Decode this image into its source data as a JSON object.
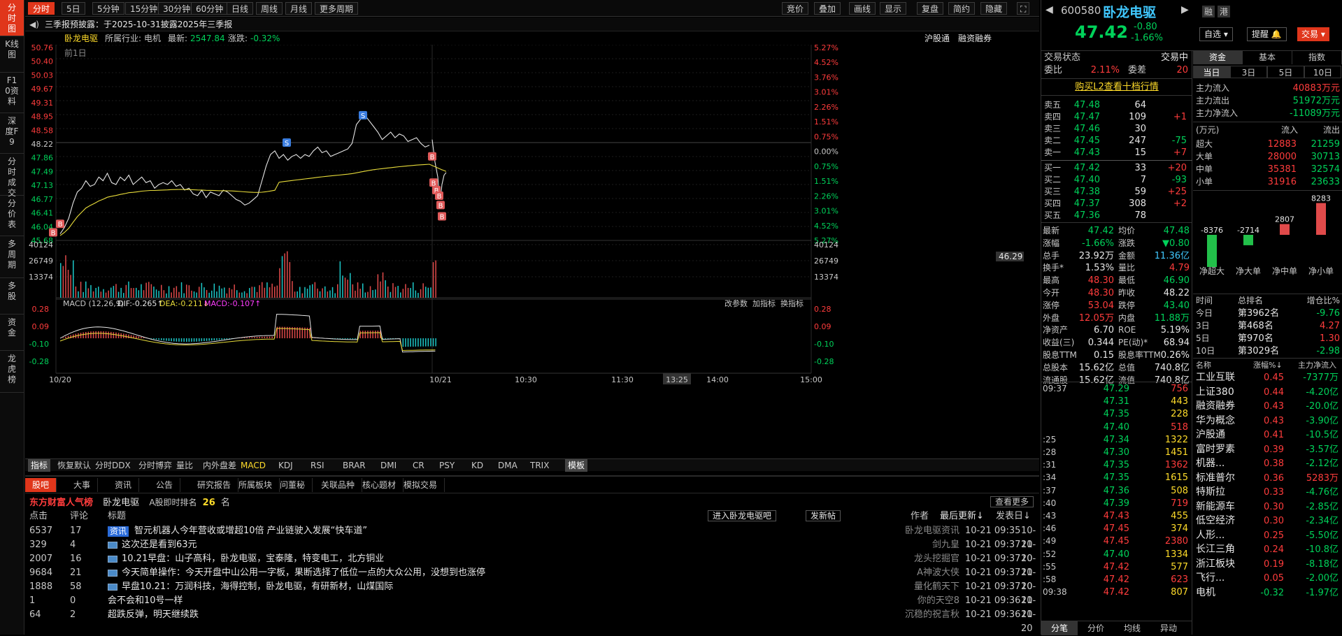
{
  "left_tabs": [
    "分时图",
    "K线图",
    "F10资料",
    "深度F9",
    "分时成交",
    "分价表",
    "多周期",
    "多股",
    "资金",
    "龙虎榜"
  ],
  "period_tabs": [
    "分时",
    "5日",
    "5分钟",
    "15分钟",
    "30分钟",
    "60分钟",
    "日线",
    "周线",
    "月线",
    "更多周期"
  ],
  "tool_buttons": [
    "竞价",
    "叠加",
    "画线",
    "显示",
    "复盘",
    "简约",
    "隐藏"
  ],
  "announcement": "三季报预披露：于2025-10-31披露2025年三季报",
  "info_line": {
    "name": "卧龙电驱",
    "industry_label": "所属行业:",
    "industry": "电机",
    "latest_label": "最新:",
    "latest": "2547.84",
    "change_label": "涨跌:",
    "change": "-0.32%",
    "hk_connect": "沪股通",
    "margin": "融资融券"
  },
  "price_axis_left": [
    "50.76",
    "50.40",
    "50.03",
    "49.67",
    "49.31",
    "48.95",
    "48.58",
    "48.22",
    "47.86",
    "47.49",
    "47.13",
    "46.77",
    "46.41",
    "46.04",
    "45.68"
  ],
  "price_axis_right": [
    "5.27%",
    "4.52%",
    "3.76%",
    "3.01%",
    "2.26%",
    "1.51%",
    "0.75%",
    "0.00%",
    "0.75%",
    "1.51%",
    "2.26%",
    "3.01%",
    "4.52%",
    "5.27%"
  ],
  "prev_day_label": "前1日",
  "current_price_tag": "46.29",
  "volume_axis": [
    "40124",
    "26749",
    "13374"
  ],
  "macd": {
    "title": "MACD (12,26,9)",
    "dif": "DIF:-0.265↑",
    "dea": "DEA:-0.211↓",
    "macd": "MACD:-0.107↑",
    "axis": [
      "0.28",
      "0.09",
      "-0.10",
      "-0.28"
    ],
    "buttons": [
      "改参数",
      "加指标",
      "换指标"
    ]
  },
  "time_axis": [
    "10/20",
    "10/21",
    "10:30",
    "11:30",
    "13:25",
    "14:00",
    "15:00"
  ],
  "indicator_tabs": [
    "指标",
    "恢复默认",
    "分时DDX",
    "分时博弈",
    "量比",
    "内外盘差",
    "MACD",
    "KDJ",
    "RSI",
    "BRAR",
    "DMI",
    "CR",
    "PSY",
    "KD",
    "DMA",
    "TRIX",
    "模板"
  ],
  "forum": {
    "tabs": [
      "股吧",
      "大事",
      "资讯",
      "公告",
      "研究报告",
      "所属板块",
      "问董秘",
      "关联品种",
      "核心题材",
      "模拟交易"
    ],
    "popularity_title": "东方财富人气榜",
    "stock": "卧龙电驱",
    "rank_label": "A股即时排名",
    "rank": "26",
    "rank_unit": "名",
    "more": "查看更多",
    "col_clicks": "点击",
    "col_comments": "评论",
    "col_title": "标题",
    "enter_btn": "进入卧龙电驱吧",
    "post_btn": "发新帖",
    "col_author": "作者",
    "col_updated": "最后更新↓",
    "col_posted": "发表日↓",
    "rows": [
      {
        "clicks": "6537",
        "comments": "17",
        "tag": "资讯",
        "title": "智元机器人今年营收或增超10倍 产业链驶入发展“快车道”",
        "author": "卧龙电驱资讯",
        "updated": "10-21 09:35",
        "posted": "10-21"
      },
      {
        "clicks": "329",
        "comments": "4",
        "tag": "",
        "title": "这次还是看到63元",
        "author": "剑九皇",
        "updated": "10-21 09:37",
        "posted": "10-20"
      },
      {
        "clicks": "2007",
        "comments": "16",
        "tag": "",
        "title": "10.21早盘：山子高科，卧龙电驱，宝泰隆，特变电工，北方铜业",
        "author": "龙头挖掘官",
        "updated": "10-21 09:37",
        "posted": "10-21"
      },
      {
        "clicks": "9684",
        "comments": "21",
        "tag": "",
        "title": "今天简单操作：今天开盘中山公用一字板，果断选择了低位一点的大众公用，没想到也涨停",
        "author": "A神波大侠",
        "updated": "10-21 09:37",
        "posted": "10-20"
      },
      {
        "clicks": "1888",
        "comments": "58",
        "tag": "",
        "title": "早盘10.21：万润科技，海得控制，卧龙电驱，有研新材，山煤国际",
        "author": "量化鹤天下",
        "updated": "10-21 09:37",
        "posted": "10-21"
      },
      {
        "clicks": "1",
        "comments": "0",
        "tag": "",
        "title": "会不会和10号一样",
        "author": "你的天空8",
        "updated": "10-21 09:36",
        "posted": "10-21"
      },
      {
        "clicks": "64",
        "comments": "2",
        "tag": "",
        "title": "超跌反弹，明天继续跌",
        "author": "沉稳的祝言秋",
        "updated": "10-21 09:36",
        "posted": "10-20"
      }
    ]
  },
  "quote": {
    "code": "600580",
    "name": "卧龙电驱",
    "btn_rong": "融",
    "btn_gang": "港",
    "price": "47.42",
    "change": "-0.80",
    "pct": "-1.66%",
    "watch": "自选",
    "alert": "提醒",
    "trade": "交易",
    "status_label": "交易状态",
    "status": "交易中",
    "ratio_label": "委比",
    "ratio": "2.11%",
    "diff_label": "委差",
    "diff": "20",
    "l2_link": "购买L2查看十档行情",
    "asks": [
      {
        "label": "卖五",
        "price": "47.48",
        "vol": "64",
        "chg": ""
      },
      {
        "label": "卖四",
        "price": "47.47",
        "vol": "109",
        "chg": "+1"
      },
      {
        "label": "卖三",
        "price": "47.46",
        "vol": "30",
        "chg": ""
      },
      {
        "label": "卖二",
        "price": "47.45",
        "vol": "247",
        "chg": "-75"
      },
      {
        "label": "卖一",
        "price": "47.43",
        "vol": "15",
        "chg": "+7"
      }
    ],
    "bids": [
      {
        "label": "买一",
        "price": "47.42",
        "vol": "33",
        "chg": "+20"
      },
      {
        "label": "买二",
        "price": "47.40",
        "vol": "7",
        "chg": "-93"
      },
      {
        "label": "买三",
        "price": "47.38",
        "vol": "59",
        "chg": "+25"
      },
      {
        "label": "买四",
        "price": "47.37",
        "vol": "308",
        "chg": "+2"
      },
      {
        "label": "买五",
        "price": "47.36",
        "vol": "78",
        "chg": ""
      }
    ],
    "stats": [
      [
        "最新",
        "47.42",
        "均价",
        "47.48"
      ],
      [
        "涨幅",
        "-1.66%",
        "涨跌",
        "▼0.80"
      ],
      [
        "总手",
        "23.92万",
        "金额",
        "11.36亿"
      ],
      [
        "换手*",
        "1.53%",
        "量比",
        "4.79"
      ],
      [
        "最高",
        "48.30",
        "最低",
        "46.90"
      ],
      [
        "今开",
        "48.30",
        "昨收",
        "48.22"
      ],
      [
        "涨停",
        "53.04",
        "跌停",
        "43.40"
      ],
      [
        "外盘",
        "12.05万",
        "内盘",
        "11.88万"
      ],
      [
        "净资产",
        "6.70",
        "ROE",
        "5.19%"
      ],
      [
        "收益(三)",
        "0.344",
        "PE(动)*",
        "68.94"
      ],
      [
        "股息TTM",
        "0.15",
        "股息率TTM",
        "0.26%"
      ],
      [
        "总股本",
        "15.62亿",
        "总值",
        "740.8亿"
      ],
      [
        "流通股",
        "15.62亿",
        "流值",
        "740.8亿"
      ]
    ],
    "ticks": [
      {
        "t": "09:37",
        "p": "47.29",
        "v": "756"
      },
      {
        "t": "",
        "p": "47.31",
        "v": "443"
      },
      {
        "t": "",
        "p": "47.35",
        "v": "228"
      },
      {
        "t": "",
        "p": "47.40",
        "v": "518"
      },
      {
        "t": ":25",
        "p": "47.34",
        "v": "1322"
      },
      {
        "t": ":28",
        "p": "47.30",
        "v": "1451"
      },
      {
        "t": ":31",
        "p": "47.35",
        "v": "1362"
      },
      {
        "t": ":34",
        "p": "47.35",
        "v": "1615"
      },
      {
        "t": ":37",
        "p": "47.36",
        "v": "508"
      },
      {
        "t": ":40",
        "p": "47.39",
        "v": "719"
      },
      {
        "t": ":43",
        "p": "47.43",
        "v": "455"
      },
      {
        "t": ":46",
        "p": "47.45",
        "v": "374"
      },
      {
        "t": ":49",
        "p": "47.45",
        "v": "2380"
      },
      {
        "t": ":52",
        "p": "47.40",
        "v": "1334"
      },
      {
        "t": ":55",
        "p": "47.42",
        "v": "577"
      },
      {
        "t": ":58",
        "p": "47.42",
        "v": "623"
      },
      {
        "t": "09:38",
        "p": "47.42",
        "v": "807"
      }
    ],
    "bottom_tabs": [
      "分笔",
      "分价",
      "均线",
      "异动"
    ]
  },
  "fund": {
    "tabs": [
      "资金",
      "基本",
      "指数"
    ],
    "period_tabs": [
      "当日",
      "3日",
      "5日",
      "10日"
    ],
    "inflow_label": "主力流入",
    "inflow": "40883万元",
    "outflow_label": "主力流出",
    "outflow": "51972万元",
    "net_label": "主力净流入",
    "net": "-11089万元",
    "unit": "(万元)",
    "in_label": "流入",
    "out_label": "流出",
    "sizes": [
      [
        "超大",
        "12883",
        "21259"
      ],
      [
        "大单",
        "28000",
        "30713"
      ],
      [
        "中单",
        "35381",
        "32574"
      ],
      [
        "小单",
        "31916",
        "23633"
      ]
    ],
    "bar_values": [
      "-8376",
      "-2714",
      "2807",
      "8283"
    ],
    "bar_labels": [
      "净超大",
      "净大单",
      "净中单",
      "净小单"
    ],
    "rank_head": [
      "时间",
      "总排名",
      "增仓比%"
    ],
    "ranks": [
      [
        "今日",
        "第3962名",
        "-9.76"
      ],
      [
        "3日",
        "第468名",
        "4.27"
      ],
      [
        "5日",
        "第970名",
        "1.30"
      ],
      [
        "10日",
        "第3029名",
        "-2.98"
      ]
    ],
    "sector_head": [
      "名称",
      "涨幅%↓",
      "主力净流入"
    ],
    "sectors": [
      [
        "工业互联",
        "0.45",
        "-7377万"
      ],
      [
        "上证380",
        "0.44",
        "-4.20亿"
      ],
      [
        "融资融券",
        "0.43",
        "-20.0亿"
      ],
      [
        "华为概念",
        "0.43",
        "-3.90亿"
      ],
      [
        "沪股通",
        "0.41",
        "-10.5亿"
      ],
      [
        "富时罗素",
        "0.39",
        "-3.57亿"
      ],
      [
        "机器...",
        "0.38",
        "-2.12亿"
      ],
      [
        "标准普尔",
        "0.36",
        "5283万"
      ],
      [
        "特斯拉",
        "0.33",
        "-4.76亿"
      ],
      [
        "新能源车",
        "0.30",
        "-2.85亿"
      ],
      [
        "低空经济",
        "0.30",
        "-2.34亿"
      ],
      [
        "人形...",
        "0.25",
        "-5.50亿"
      ],
      [
        "长江三角",
        "0.24",
        "-10.8亿"
      ],
      [
        "浙江板块",
        "0.19",
        "-8.18亿"
      ],
      [
        "飞行...",
        "0.05",
        "-2.00亿"
      ],
      [
        "电机",
        "-0.32",
        "-1.97亿"
      ]
    ]
  }
}
